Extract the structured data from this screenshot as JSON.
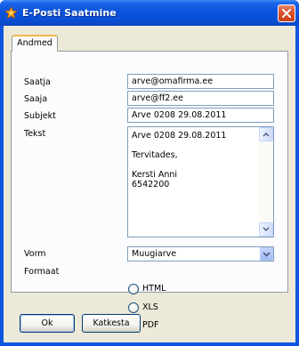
{
  "window": {
    "title": "E-Posti Saatmine",
    "icon": "app-logo-icon",
    "close_icon": "close-icon"
  },
  "tabs": [
    {
      "label": "Andmed",
      "active": true
    }
  ],
  "form": {
    "sender": {
      "label": "Saatja",
      "value": "arve@omafirma.ee"
    },
    "recipient": {
      "label": "Saaja",
      "value": "arve@ff2.ee"
    },
    "subject": {
      "label": "Subjekt",
      "value": "Arve 0208 29.08.2011"
    },
    "body": {
      "label": "Tekst",
      "lines": [
        "Arve 0208 29.08.2011",
        "",
        "Tervitades,",
        "",
        "Kersti Anni",
        "6542200"
      ]
    },
    "template": {
      "label": "Vorm",
      "value": "Muugiarve"
    },
    "format": {
      "label": "Formaat",
      "options": [
        "HTML",
        "XLS",
        "PDF"
      ],
      "selected": "PDF"
    }
  },
  "buttons": {
    "ok": "Ok",
    "cancel": "Katkesta"
  },
  "colors": {
    "titlebar": "#0a54dc",
    "dialog_bg": "#ece9d8",
    "tab_accent": "#f2b64d",
    "close_button": "#d9532c"
  }
}
